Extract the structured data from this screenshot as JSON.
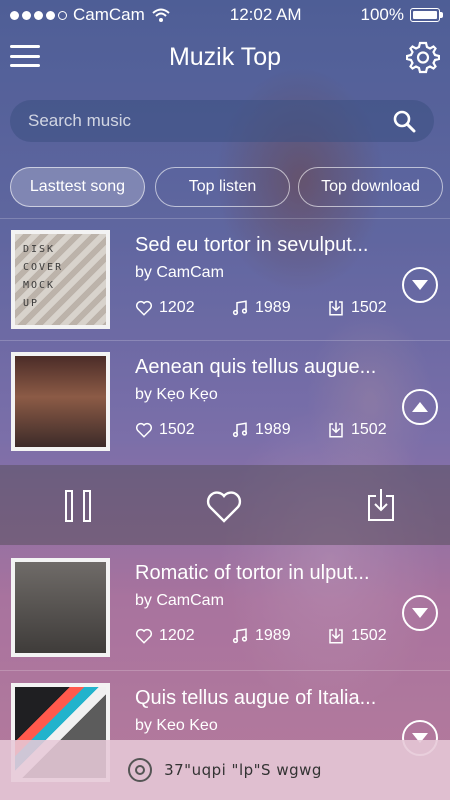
{
  "status": {
    "carrier": "CamCam",
    "time": "12:02 AM",
    "battery": "100%"
  },
  "header": {
    "title": "Muzik Top"
  },
  "search": {
    "placeholder": "Search music"
  },
  "tabs": [
    {
      "label": "Lasttest song",
      "active": true
    },
    {
      "label": "Top listen",
      "active": false
    },
    {
      "label": "Top download",
      "active": false
    }
  ],
  "songs": [
    {
      "title": "Sed eu tortor in sevulput...",
      "artist": "by CamCam",
      "likes": "1202",
      "plays": "1989",
      "downloads": "1502",
      "expanded": false
    },
    {
      "title": "Aenean quis tellus augue...",
      "artist": "by Kẹo Kẹo",
      "likes": "1502",
      "plays": "1989",
      "downloads": "1502",
      "expanded": true
    },
    {
      "title": "Romatic of tortor in ulput...",
      "artist": "by CamCam",
      "likes": "1202",
      "plays": "1989",
      "downloads": "1502",
      "expanded": false
    },
    {
      "title": "Quis tellus augue of Italia...",
      "artist": "by Keo Keo",
      "likes": "",
      "plays": "",
      "downloads": "",
      "expanded": false
    }
  ],
  "now_playing": {
    "text": "37\"uqpi \"lp\"S wgwg"
  },
  "icons": {
    "menu": "hamburger-menu-icon",
    "settings": "gear-icon",
    "search": "search-icon",
    "like": "heart-icon",
    "plays": "music-note-icon",
    "download": "download-icon",
    "expand": "chevron-down-icon",
    "collapse": "chevron-up-icon",
    "pause": "pause-icon",
    "disc": "disc-icon"
  }
}
